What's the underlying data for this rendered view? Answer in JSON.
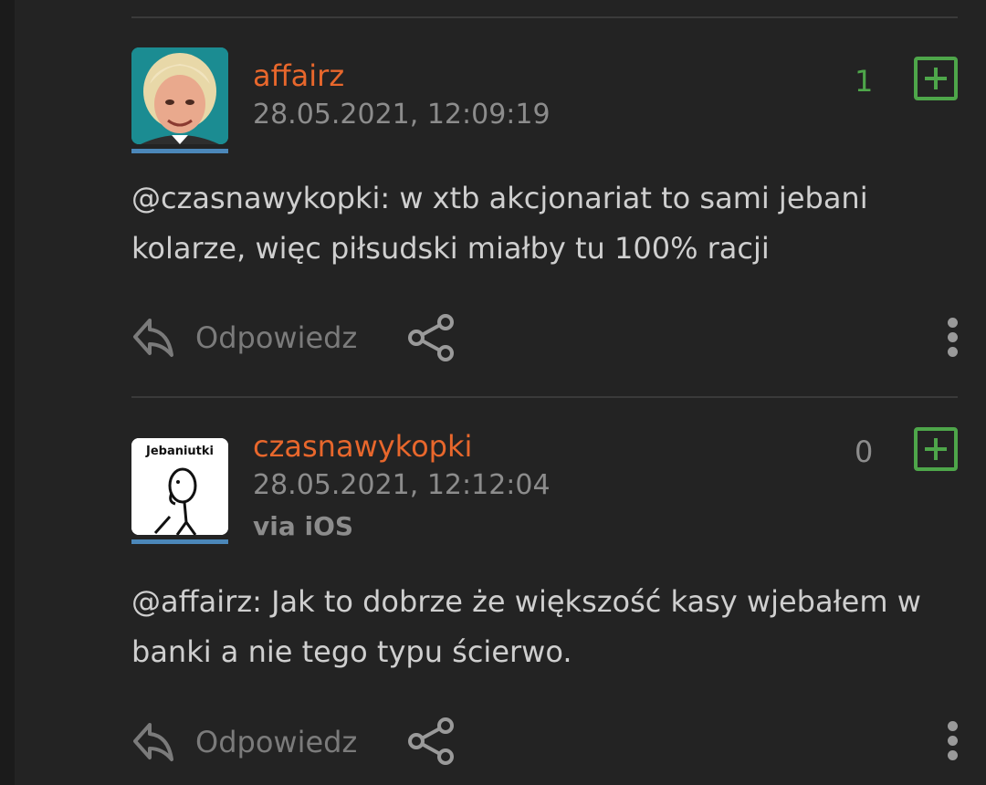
{
  "comments": [
    {
      "username": "affairz",
      "timestamp": "28.05.2021, 12:09:19",
      "vote_count": "1",
      "mention": "@czasnawykopki",
      "text": ": w xtb akcjonariat to sami jebani kolarze, więc piłsudski miałby tu 100% racji",
      "reply_label": "Odpowiedz",
      "avatar_icon": "man-with-grey-hair-avatar"
    },
    {
      "username": "czasnawykopki",
      "timestamp": "28.05.2021, 12:12:04",
      "via": "via iOS",
      "vote_count": "0",
      "mention": "@affairz",
      "text": ": Jak to dobrze że większość kasy wjebałem w banki a nie tego typu ścierwo.",
      "reply_label": "Odpowiedz",
      "avatar_label": "Jebaniutki",
      "avatar_icon": "stick-figure-avatar"
    }
  ],
  "colors": {
    "background": "#232323",
    "username": "#e8672c",
    "vote_positive": "#4ea64a",
    "vote_zero": "#8c8c8c",
    "plus_button": "#4ea64a",
    "avatar_underline": "#4b87b9"
  }
}
